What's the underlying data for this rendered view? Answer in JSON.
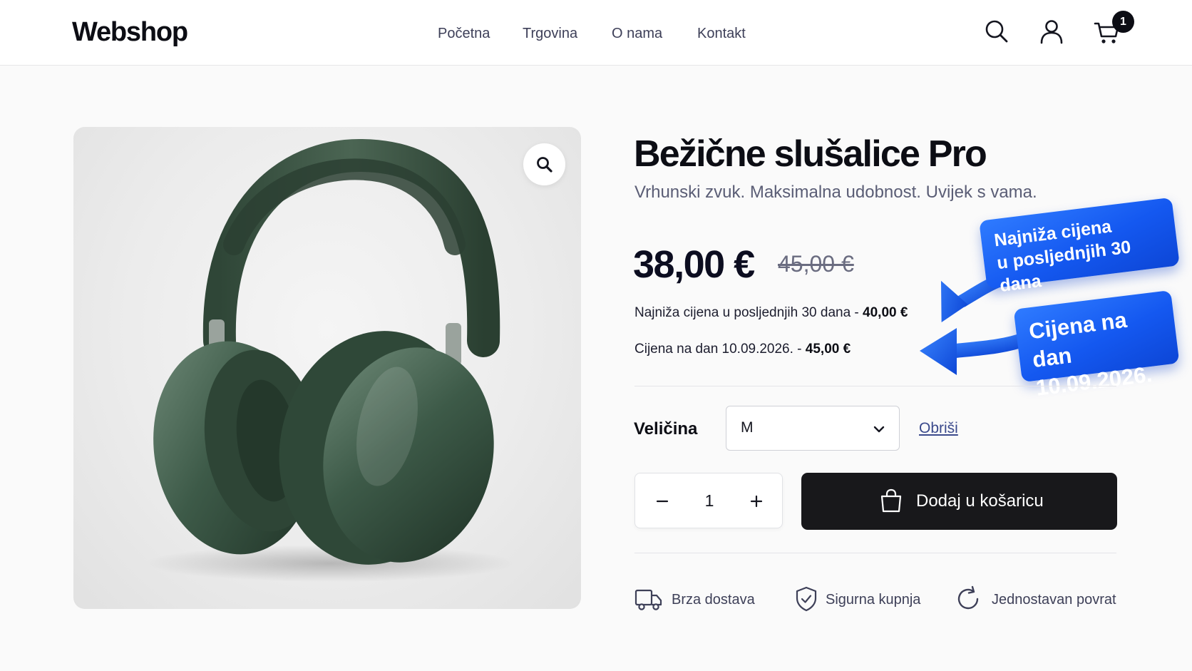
{
  "header": {
    "logo": "Webshop",
    "nav": [
      "Početna",
      "Trgovina",
      "O nama",
      "Kontakt"
    ],
    "icons": [
      "search-icon",
      "user-icon",
      "cart-icon"
    ],
    "cart_count": "1"
  },
  "product": {
    "title": "Bežične slušalice Pro",
    "subtitle": "Vrhunski zvuk. Maksimalna udobnost. Uvijek s vama.",
    "price": "38,00 €",
    "old_price": "45,00 €",
    "lowest_price_text": "Najniža cijena u posljednjih 30 dana - ",
    "lowest_price_value": "40,00 €",
    "date_price_text": "Cijena na dan 10.09.2026. - ",
    "date_price_value": "45,00 €"
  },
  "callouts": {
    "lowest_line1": "Najniža cijena",
    "lowest_line2": "u posljednjih 30 dana",
    "date_line1": "Cijena na dan",
    "date_line2": "10.09.2026."
  },
  "options": {
    "size_label": "Veličina",
    "size_value": "M",
    "clear_label": "Obriši"
  },
  "cart": {
    "quantity": "1",
    "add_label": "Dodaj u košaricu"
  },
  "features": [
    {
      "icon": "truck-icon",
      "label": "Brza dostava"
    },
    {
      "icon": "shield-check-icon",
      "label": "Sigurna kupnja"
    },
    {
      "icon": "refresh-icon",
      "label": "Jednostavan povrat"
    }
  ],
  "colors": {
    "accent_blue": "#1458f0",
    "button_dark": "#18181b",
    "headphone_green": "#3d5a48"
  }
}
